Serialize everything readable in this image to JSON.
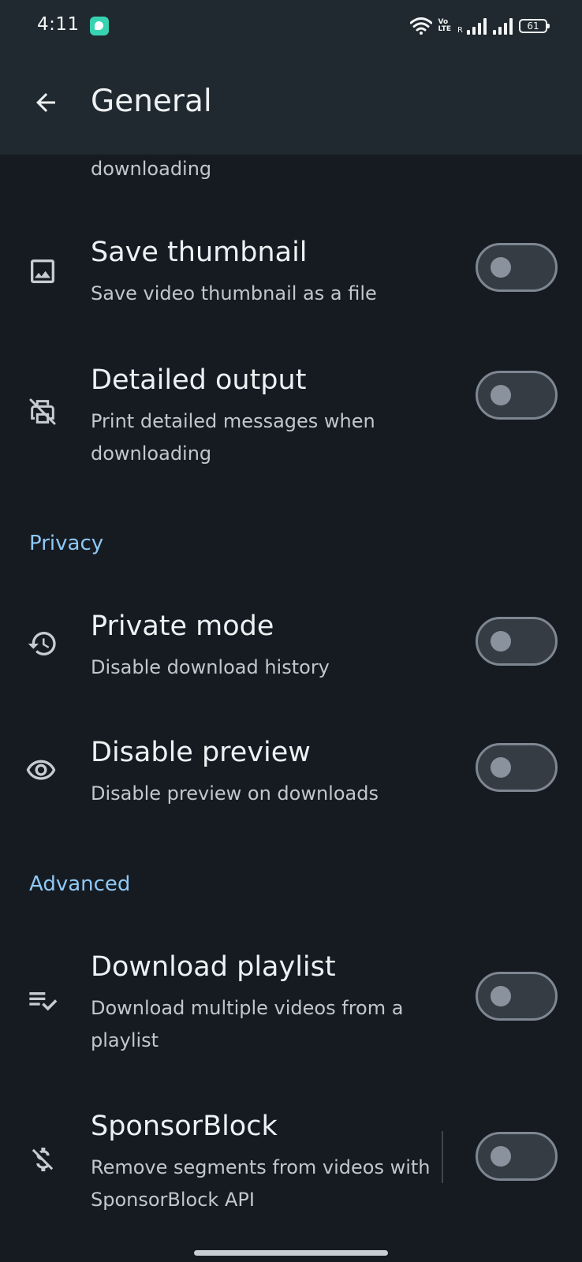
{
  "status_bar": {
    "time": "4:11",
    "volte_top": "Vo",
    "volte_bottom": "LTE",
    "roaming": "R",
    "battery": "61"
  },
  "app_bar": {
    "title": "General"
  },
  "partial_item": {
    "description_tail": "downloading"
  },
  "sections": [
    {
      "header": "",
      "items": [
        {
          "title": "Save thumbnail",
          "description": "Save video thumbnail as a file",
          "icon": "image-icon",
          "enabled": false
        },
        {
          "title": "Detailed output",
          "description": "Print detailed messages when downloading",
          "icon": "print-disabled-icon",
          "enabled": false
        }
      ]
    },
    {
      "header": "Privacy",
      "items": [
        {
          "title": "Private mode",
          "description": "Disable download history",
          "icon": "history-icon",
          "enabled": false
        },
        {
          "title": "Disable preview",
          "description": "Disable preview on downloads",
          "icon": "eye-icon",
          "enabled": false
        }
      ]
    },
    {
      "header": "Advanced",
      "items": [
        {
          "title": "Download playlist",
          "description": "Download multiple videos from a playlist",
          "icon": "playlist-check-icon",
          "enabled": false
        },
        {
          "title": "SponsorBlock",
          "description": "Remove segments from videos with SponsorBlock API",
          "icon": "money-off-icon",
          "enabled": false
        }
      ]
    }
  ],
  "colors": {
    "background": "#161b22",
    "app_bar": "#1f292f",
    "section_header": "#8fc9f5",
    "toggle_track": "#363c44",
    "toggle_outline": "#7e8791"
  }
}
